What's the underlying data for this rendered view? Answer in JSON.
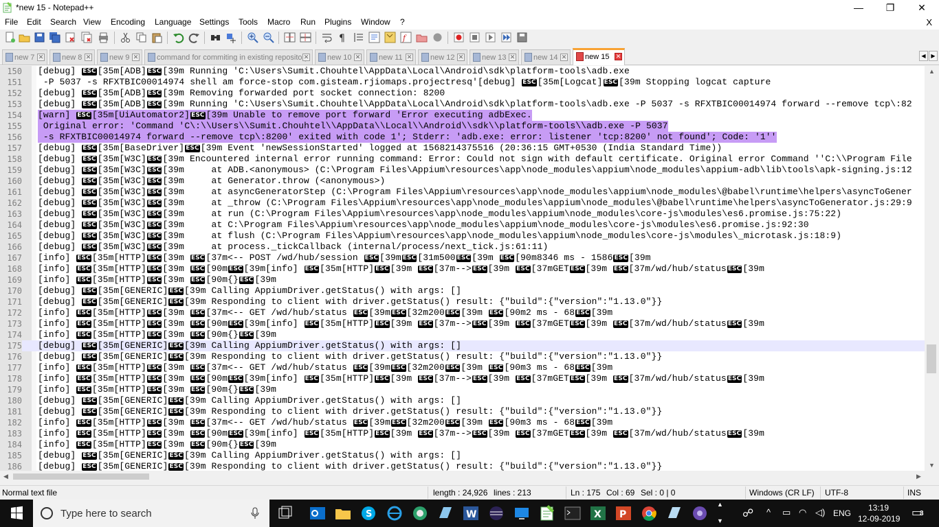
{
  "window": {
    "title": "*new 15 - Notepad++"
  },
  "menu": [
    "File",
    "Edit",
    "Search",
    "View",
    "Encoding",
    "Language",
    "Settings",
    "Tools",
    "Macro",
    "Run",
    "Plugins",
    "Window",
    "?"
  ],
  "menu_close": "X",
  "tabs": [
    {
      "label": "new 7",
      "active": false
    },
    {
      "label": "new 8",
      "active": false
    },
    {
      "label": "new 9",
      "active": false
    },
    {
      "label": "command for commiting in existing repository",
      "active": false
    },
    {
      "label": "new 10",
      "active": false
    },
    {
      "label": "new 11",
      "active": false
    },
    {
      "label": "new 12",
      "active": false
    },
    {
      "label": "new 13",
      "active": false
    },
    {
      "label": "new 14",
      "active": false
    },
    {
      "label": "new 15",
      "active": true
    }
  ],
  "editor": {
    "lines": [
      {
        "n": "150",
        "t": "[debug] ‹ESC›[35m[ADB]‹ESC›[39m Running 'C:\\Users\\Sumit.Chouhtel\\AppData\\Local\\Android\\sdk\\platform-tools\\adb.exe"
      },
      {
        "n": "151",
        "t": " -P 5037 -s RFXTBIC00014974 shell am force-stop com.gisteam.rjiomaps.projectresq'[debug] ‹ESC›[35m[Logcat]‹ESC›[39m Stopping logcat capture"
      },
      {
        "n": "152",
        "t": "[debug] ‹ESC›[35m[ADB]‹ESC›[39m Removing forwarded port socket connection: 8200"
      },
      {
        "n": "153",
        "t": "[debug] ‹ESC›[35m[ADB]‹ESC›[39m Running 'C:\\Users\\Sumit.Chouhtel\\AppData\\Local\\Android\\sdk\\platform-tools\\adb.exe -P 5037 -s RFXTBIC00014974 forward --remove tcp\\:82"
      },
      {
        "n": "154",
        "t": "[warn] ‹ESC›[35m[UiAutomator2]‹ESC›[39m Unable to remove port forward 'Error executing adbExec.",
        "sel": true
      },
      {
        "n": "155",
        "t": " Original error: 'Command 'C\\:\\\\Users\\\\Sumit.Chouhtel\\\\AppData\\\\Local\\\\Android\\\\sdk\\\\platform-tools\\\\adb.exe -P 5037",
        "sel": true
      },
      {
        "n": "156",
        "t": " -s RFXTBIC00014974 forward --remove tcp\\:8200' exited with code 1'; Stderr: 'adb.exe: error: listener 'tcp:8200' not found'; Code: '1''",
        "sel": true
      },
      {
        "n": "157",
        "t": "[debug] ‹ESC›[35m[BaseDriver]‹ESC›[39m Event 'newSessionStarted' logged at 1568214375516 (20:36:15 GMT+0530 (India Standard Time))"
      },
      {
        "n": "158",
        "t": "[debug] ‹ESC›[35m[W3C]‹ESC›[39m Encountered internal error running command: Error: Could not sign with default certificate. Original error Command ''C:\\\\Program File"
      },
      {
        "n": "159",
        "t": "[debug] ‹ESC›[35m[W3C]‹ESC›[39m     at ADB.<anonymous> (C:\\Program Files\\Appium\\resources\\app\\node_modules\\appium\\node_modules\\appium-adb\\lib\\tools\\apk-signing.js:12"
      },
      {
        "n": "160",
        "t": "[debug] ‹ESC›[35m[W3C]‹ESC›[39m     at Generator.throw (<anonymous>)"
      },
      {
        "n": "161",
        "t": "[debug] ‹ESC›[35m[W3C]‹ESC›[39m     at asyncGeneratorStep (C:\\Program Files\\Appium\\resources\\app\\node_modules\\appium\\node_modules\\@babel\\runtime\\helpers\\asyncToGener"
      },
      {
        "n": "162",
        "t": "[debug] ‹ESC›[35m[W3C]‹ESC›[39m     at _throw (C:\\Program Files\\Appium\\resources\\app\\node_modules\\appium\\node_modules\\@babel\\runtime\\helpers\\asyncToGenerator.js:29:9"
      },
      {
        "n": "163",
        "t": "[debug] ‹ESC›[35m[W3C]‹ESC›[39m     at run (C:\\Program Files\\Appium\\resources\\app\\node_modules\\appium\\node_modules\\core-js\\modules\\es6.promise.js:75:22)"
      },
      {
        "n": "164",
        "t": "[debug] ‹ESC›[35m[W3C]‹ESC›[39m     at C:\\Program Files\\Appium\\resources\\app\\node_modules\\appium\\node_modules\\core-js\\modules\\es6.promise.js:92:30"
      },
      {
        "n": "165",
        "t": "[debug] ‹ESC›[35m[W3C]‹ESC›[39m     at flush (C:\\Program Files\\Appium\\resources\\app\\node_modules\\appium\\node_modules\\core-js\\modules\\_microtask.js:18:9)"
      },
      {
        "n": "166",
        "t": "[debug] ‹ESC›[35m[W3C]‹ESC›[39m     at process._tickCallback (internal/process/next_tick.js:61:11)"
      },
      {
        "n": "167",
        "t": "[info] ‹ESC›[35m[HTTP]‹ESC›[39m ‹ESC›[37m<-- POST /wd/hub/session ‹ESC›[39m‹ESC›[31m500‹ESC›[39m ‹ESC›[90m8346 ms - 1586‹ESC›[39m"
      },
      {
        "n": "168",
        "t": "[info] ‹ESC›[35m[HTTP]‹ESC›[39m ‹ESC›[90m‹ESC›[39m[info] ‹ESC›[35m[HTTP]‹ESC›[39m ‹ESC›[37m-->‹ESC›[39m ‹ESC›[37mGET‹ESC›[39m ‹ESC›[37m/wd/hub/status‹ESC›[39m"
      },
      {
        "n": "169",
        "t": "[info] ‹ESC›[35m[HTTP]‹ESC›[39m ‹ESC›[90m{}‹ESC›[39m"
      },
      {
        "n": "170",
        "t": "[debug] ‹ESC›[35m[GENERIC]‹ESC›[39m Calling AppiumDriver.getStatus() with args: []"
      },
      {
        "n": "171",
        "t": "[debug] ‹ESC›[35m[GENERIC]‹ESC›[39m Responding to client with driver.getStatus() result: {\"build\":{\"version\":\"1.13.0\"}}"
      },
      {
        "n": "172",
        "t": "[info] ‹ESC›[35m[HTTP]‹ESC›[39m ‹ESC›[37m<-- GET /wd/hub/status ‹ESC›[39m‹ESC›[32m200‹ESC›[39m ‹ESC›[90m2 ms - 68‹ESC›[39m"
      },
      {
        "n": "173",
        "t": "[info] ‹ESC›[35m[HTTP]‹ESC›[39m ‹ESC›[90m‹ESC›[39m[info] ‹ESC›[35m[HTTP]‹ESC›[39m ‹ESC›[37m-->‹ESC›[39m ‹ESC›[37mGET‹ESC›[39m ‹ESC›[37m/wd/hub/status‹ESC›[39m"
      },
      {
        "n": "174",
        "t": "[info] ‹ESC›[35m[HTTP]‹ESC›[39m ‹ESC›[90m{}‹ESC›[39m"
      },
      {
        "n": "175",
        "t": "[debug] ‹ESC›[35m[GENERIC]‹ESC›[39m Calling AppiumDriver.getStatus() with args: []",
        "cur": true
      },
      {
        "n": "176",
        "t": "[debug] ‹ESC›[35m[GENERIC]‹ESC›[39m Responding to client with driver.getStatus() result: {\"build\":{\"version\":\"1.13.0\"}}"
      },
      {
        "n": "177",
        "t": "[info] ‹ESC›[35m[HTTP]‹ESC›[39m ‹ESC›[37m<-- GET /wd/hub/status ‹ESC›[39m‹ESC›[32m200‹ESC›[39m ‹ESC›[90m3 ms - 68‹ESC›[39m"
      },
      {
        "n": "178",
        "t": "[info] ‹ESC›[35m[HTTP]‹ESC›[39m ‹ESC›[90m‹ESC›[39m[info] ‹ESC›[35m[HTTP]‹ESC›[39m ‹ESC›[37m-->‹ESC›[39m ‹ESC›[37mGET‹ESC›[39m ‹ESC›[37m/wd/hub/status‹ESC›[39m"
      },
      {
        "n": "179",
        "t": "[info] ‹ESC›[35m[HTTP]‹ESC›[39m ‹ESC›[90m{}‹ESC›[39m"
      },
      {
        "n": "180",
        "t": "[debug] ‹ESC›[35m[GENERIC]‹ESC›[39m Calling AppiumDriver.getStatus() with args: []"
      },
      {
        "n": "181",
        "t": "[debug] ‹ESC›[35m[GENERIC]‹ESC›[39m Responding to client with driver.getStatus() result: {\"build\":{\"version\":\"1.13.0\"}}"
      },
      {
        "n": "182",
        "t": "[info] ‹ESC›[35m[HTTP]‹ESC›[39m ‹ESC›[37m<-- GET /wd/hub/status ‹ESC›[39m‹ESC›[32m200‹ESC›[39m ‹ESC›[90m3 ms - 68‹ESC›[39m"
      },
      {
        "n": "183",
        "t": "[info] ‹ESC›[35m[HTTP]‹ESC›[39m ‹ESC›[90m‹ESC›[39m[info] ‹ESC›[35m[HTTP]‹ESC›[39m ‹ESC›[37m-->‹ESC›[39m ‹ESC›[37mGET‹ESC›[39m ‹ESC›[37m/wd/hub/status‹ESC›[39m"
      },
      {
        "n": "184",
        "t": "[info] ‹ESC›[35m[HTTP]‹ESC›[39m ‹ESC›[90m{}‹ESC›[39m"
      },
      {
        "n": "185",
        "t": "[debug] ‹ESC›[35m[GENERIC]‹ESC›[39m Calling AppiumDriver.getStatus() with args: []"
      },
      {
        "n": "186",
        "t": "[debug] ‹ESC›[35m[GENERIC]‹ESC›[39m Responding to client with driver.getStatus() result: {\"build\":{\"version\":\"1.13.0\"}}"
      }
    ]
  },
  "status": {
    "file_type": "Normal text file",
    "length": "length : 24,926",
    "lines": "lines : 213",
    "ln": "Ln : 175",
    "col": "Col : 69",
    "sel": "Sel : 0 | 0",
    "eol": "Windows (CR LF)",
    "encoding": "UTF-8",
    "mode": "INS"
  },
  "taskbar": {
    "search_placeholder": "Type here to search",
    "language": "ENG",
    "time": "13:19",
    "date": "12-09-2019",
    "notifications": "3"
  },
  "colors": {
    "selection": "#c79cf5",
    "current_line": "#e8e8ff",
    "active_tab_accent": "#f9a233"
  }
}
